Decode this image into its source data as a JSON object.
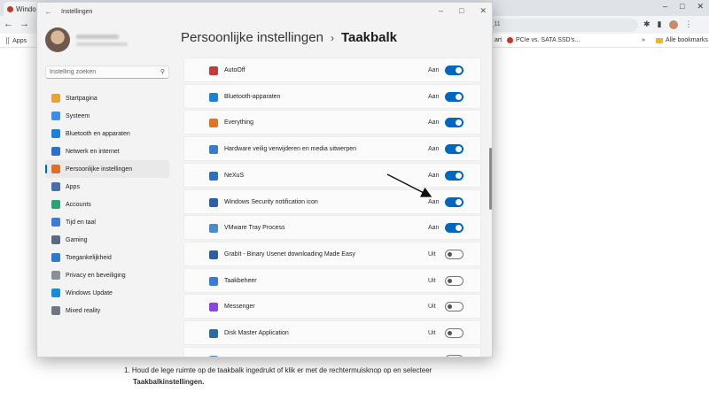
{
  "browser": {
    "tab_title": "Windo",
    "omnibox_fragment": "s_11",
    "bookmarks": [
      "Apps",
      "art",
      "PCIe vs. SATA SSD's...",
      "Alle bookmarks"
    ],
    "page_text_line1": "1.  Houd de lege ruimte op de taakbalk ingedrukt of klik er met de rechtermuisknop op en selecteer",
    "page_text_bold": "Taakbalkinstellingen."
  },
  "window": {
    "title": "Instellingen"
  },
  "search": {
    "placeholder": "Instelling zoeken"
  },
  "breadcrumb": {
    "parent": "Persoonlijke instellingen",
    "separator": "›",
    "current": "Taakbalk"
  },
  "nav": {
    "items": [
      {
        "label": "Startpagina",
        "color": "#e8a23a",
        "active": false
      },
      {
        "label": "Systeem",
        "color": "#3a8ee6",
        "active": false
      },
      {
        "label": "Bluetooth en apparaten",
        "color": "#1f7fd6",
        "active": false
      },
      {
        "label": "Netwerk en internet",
        "color": "#2d6fcf",
        "active": false
      },
      {
        "label": "Persoonlijke instellingen",
        "color": "#d9702c",
        "active": true
      },
      {
        "label": "Apps",
        "color": "#4a6fa5",
        "active": false
      },
      {
        "label": "Accounts",
        "color": "#2aa37a",
        "active": false
      },
      {
        "label": "Tijd en taal",
        "color": "#3c7bd8",
        "active": false
      },
      {
        "label": "Gaming",
        "color": "#5b6b7d",
        "active": false
      },
      {
        "label": "Toegankelijkheid",
        "color": "#2f78d0",
        "active": false
      },
      {
        "label": "Privacy en beveiliging",
        "color": "#8a8f96",
        "active": false
      },
      {
        "label": "Windows Update",
        "color": "#1d8ad8",
        "active": false
      },
      {
        "label": "Mixed reality",
        "color": "#6e7782",
        "active": false
      }
    ]
  },
  "apps": [
    {
      "name": "AutoOff",
      "state": "Aan",
      "on": true,
      "color": "#c23b3b"
    },
    {
      "name": "Bluetooth-apparaten",
      "state": "Aan",
      "on": true,
      "color": "#1f7fd6"
    },
    {
      "name": "Everything",
      "state": "Aan",
      "on": true,
      "color": "#d9782c"
    },
    {
      "name": "Hardware veilig verwijderen en media uitwerpen",
      "state": "Aan",
      "on": true,
      "color": "#3b7cc9"
    },
    {
      "name": "NeXuS",
      "state": "Aan",
      "on": true,
      "color": "#2f6fb8"
    },
    {
      "name": "Windows Security notification icon",
      "state": "Aan",
      "on": true,
      "color": "#2f5fa3"
    },
    {
      "name": "VMware Tray Process",
      "state": "Aan",
      "on": true,
      "color": "#4a8ad0"
    },
    {
      "name": "GrabIt - Binary Usenet downloading Made Easy",
      "state": "Uit",
      "on": false,
      "color": "#2d5e9e"
    },
    {
      "name": "Taakbeheer",
      "state": "Uit",
      "on": false,
      "color": "#3c7bd8"
    },
    {
      "name": "Messenger",
      "state": "Uit",
      "on": false,
      "color": "#8a46d8"
    },
    {
      "name": "Disk Master Application",
      "state": "Uit",
      "on": false,
      "color": "#2f6a9c"
    },
    {
      "name": "",
      "state": "Uit",
      "on": false,
      "color": "#4a7fc0"
    }
  ]
}
